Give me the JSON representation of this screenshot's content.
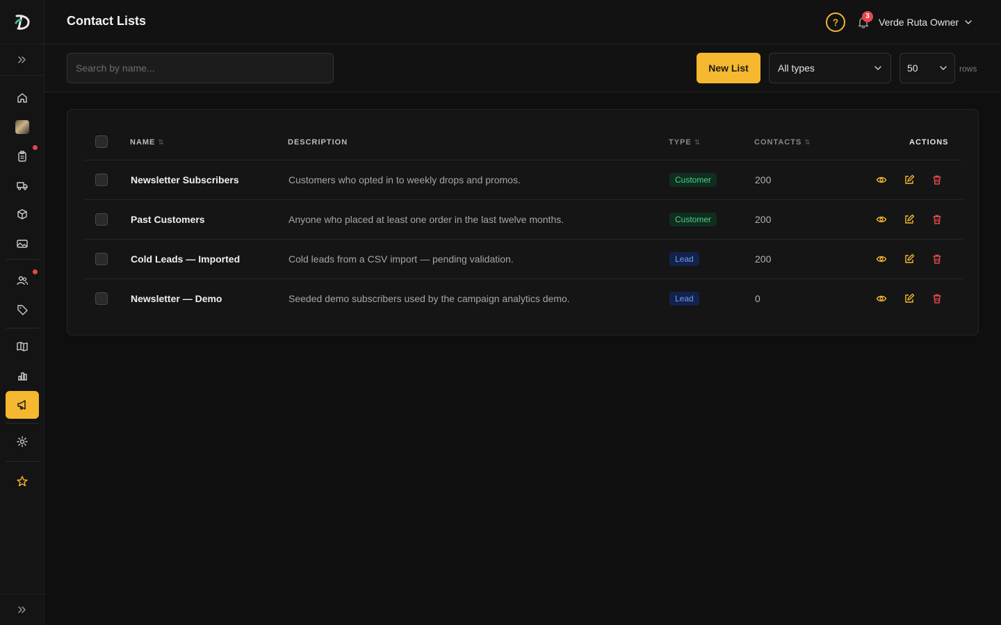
{
  "header": {
    "title": "Contact Lists",
    "notification_count": "3",
    "user_name": "Verde Ruta Owner"
  },
  "toolbar": {
    "search_placeholder": "Search by name...",
    "new_button_label": "New List",
    "type_filter": "All types",
    "rows_per_page": "50",
    "rows_label": "rows"
  },
  "table": {
    "columns": {
      "name": "NAME",
      "description": "DESCRIPTION",
      "type": "TYPE",
      "contacts": "CONTACTS",
      "actions": "ACTIONS"
    },
    "rows": [
      {
        "name": "Newsletter Subscribers",
        "description": "Customers who opted in to weekly drops and promos.",
        "type": "Customer",
        "contacts": "200"
      },
      {
        "name": "Past Customers",
        "description": "Anyone who placed at least one order in the last twelve months.",
        "type": "Customer",
        "contacts": "200"
      },
      {
        "name": "Cold Leads — Imported",
        "description": "Cold leads from a CSV import — pending validation.",
        "type": "Lead",
        "contacts": "200"
      },
      {
        "name": "Newsletter — Demo",
        "description": "Seeded demo subscribers used by the campaign analytics demo.",
        "type": "Lead",
        "contacts": "0"
      }
    ]
  },
  "sidebar": {
    "items": [
      {
        "icon": "home-icon"
      },
      {
        "icon": "avatar-image"
      },
      {
        "icon": "clipboard-icon",
        "has_alert": true
      },
      {
        "icon": "truck-icon"
      },
      {
        "icon": "box-icon"
      },
      {
        "icon": "image-icon"
      },
      {
        "icon": "users-icon",
        "has_alert": true
      },
      {
        "icon": "tag-icon"
      },
      {
        "icon": "book-icon"
      },
      {
        "icon": "bar-chart-icon"
      },
      {
        "icon": "megaphone-icon",
        "active": true
      },
      {
        "icon": "gear-icon"
      },
      {
        "icon": "star-icon"
      }
    ]
  },
  "colors": {
    "accent": "#f5b82e",
    "danger": "#e5484d",
    "background": "#0f0f10",
    "customer_badge": "#4fd08a",
    "lead_badge": "#6f9cf5"
  }
}
